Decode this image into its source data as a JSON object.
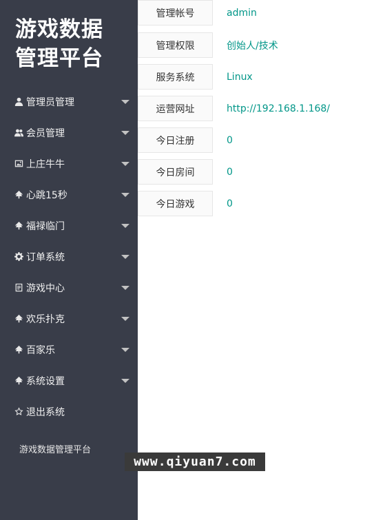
{
  "sidebar": {
    "brand_line1": "游戏数据",
    "brand_line2": "管理平台",
    "items": [
      {
        "label": "管理员管理",
        "icon": "user-icon",
        "has_submenu": true
      },
      {
        "label": "会员管理",
        "icon": "users-icon",
        "has_submenu": true
      },
      {
        "label": "上庄牛牛",
        "icon": "image-icon",
        "has_submenu": true
      },
      {
        "label": "心跳15秒",
        "icon": "tree-icon",
        "has_submenu": true
      },
      {
        "label": "福禄临门",
        "icon": "tree-icon",
        "has_submenu": true
      },
      {
        "label": "订单系统",
        "icon": "gear-icon",
        "has_submenu": true
      },
      {
        "label": "游戏中心",
        "icon": "document-icon",
        "has_submenu": true
      },
      {
        "label": "欢乐扑克",
        "icon": "tree-icon",
        "has_submenu": true
      },
      {
        "label": "百家乐",
        "icon": "tree-icon",
        "has_submenu": true
      },
      {
        "label": "系统设置",
        "icon": "tree-icon",
        "has_submenu": true
      },
      {
        "label": "退出系统",
        "icon": "star-icon",
        "has_submenu": false
      }
    ],
    "footer": "游戏数据管理平台"
  },
  "info": [
    {
      "label": "管理帐号",
      "value": "admin"
    },
    {
      "label": "管理权限",
      "value": "创始人/技术"
    },
    {
      "label": "服务系统",
      "value": "Linux"
    },
    {
      "label": "运营网址",
      "value": "http://192.168.1.168/"
    },
    {
      "label": "今日注册",
      "value": "0"
    },
    {
      "label": "今日房间",
      "value": "0"
    },
    {
      "label": "今日游戏",
      "value": "0"
    }
  ],
  "watermark": "www.qiyuan7.com",
  "colors": {
    "sidebar_bg": "#393d49",
    "accent": "#009688"
  }
}
